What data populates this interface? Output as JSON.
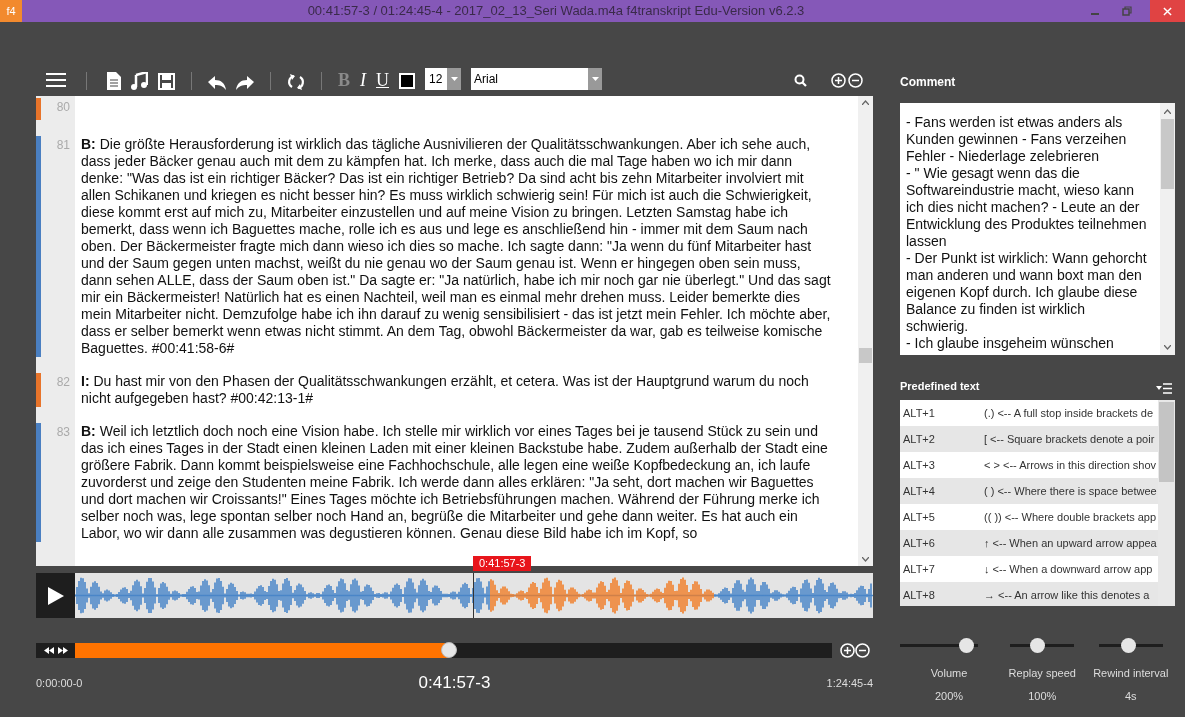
{
  "window": {
    "logo": "f4",
    "title": "00:41:57-3 / 01:24:45-4 - 2017_02_13_Seri Wada.m4a f4transkript Edu-Version v6.2.3"
  },
  "toolbar": {
    "format_buttons": [
      {
        "label": "B",
        "kind": "bold",
        "disabled": true
      },
      {
        "label": "I",
        "kind": "italic",
        "disabled": false
      },
      {
        "label": "U",
        "kind": "underline",
        "disabled": false
      }
    ],
    "font_size": "12",
    "font_family": "Arial"
  },
  "transcript": [
    {
      "number": "80",
      "color": "#e8742a"
    },
    {
      "number": "81",
      "color": "#4a7fc1",
      "text": "**B:** Die größte Herausforderung ist wirklich das tägliche Ausnivilieren der Qualitätsschwankungen. Aber ich sehe auch, dass jeder Bäcker genau auch mit dem zu kämpfen hat. Ich merke, dass auch die mal Tage haben wo ich mir dann denke: \"Was das ist ein richtiger Bäcker? Das ist ein richtiger Betrieb? Da sind acht bis zehn Mitarbeiter involviert mit allen Schikanen und kriegen es nicht besser hin? Es muss wirklich schwierig sein! Für mich ist auch die Schwierigkeit, diese kommt erst auf mich zu, Mitarbeiter einzustellen und auf meine Vision zu bringen. Letzten Samstag habe ich bemerkt, dass wenn ich Baguettes mache, rolle ich es aus und lege es anschließend hin - immer mit dem Saum nach oben. Der Bäckermeister fragte mich dann wieso ich dies so mache. Ich sagte dann: \"Ja wenn du fünf Mitarbeiter hast und der Saum gegen unten machst, weißt du nie genau wo der Saum genau ist. Wenn er hingegen oben sein muss, dann sehen ALLE, dass der Saum oben ist.\" Da sagte er: \"Ja natürlich, habe ich mir noch gar nie überlegt.\" Und das sagt mir ein Bäckermeister! Natürlich hat es einen Nachteil, weil man es einmal mehr drehen muss. Leider bemerkte dies mein Mitarbeiter nicht. Demzufolge habe ich ihn darauf zu wenig sensibilisiert - das ist jetzt mein Fehler. Ich möchte aber, dass er selber bemerkt wenn etwas nicht stimmt. An dem Tag, obwohl Bäckermeister da war, gab es teilweise komische Baguettes. #00:41:58-6#"
    },
    {
      "number": "82",
      "color": "#e8742a",
      "text": "**I:** Du hast mir von den Phasen der Qualitätsschwankungen erzählt, et cetera. Was ist der Hauptgrund warum du noch nicht aufgegeben hast? #00:42:13-1#"
    },
    {
      "number": "83",
      "color": "#4a7fc1",
      "text": "**B:** Weil ich letztlich doch noch eine Vision habe. Ich stelle mir wirklich vor eines Tages bei je tausend Stück zu sein und das ich eines Tages in der Stadt einen kleinen Laden mit einer kleinen Backstube habe. Zudem außerhalb der Stadt eine größere Fabrik. Dann kommt beispielsweise eine Fachhochschule, alle legen eine weiße Kopfbedeckung an, ich laufe zuvorderst und zeige den Studenten meine Fabrik. Ich werde dann alles erklären: \"Ja seht, dort machen wir Baguettes und dort machen wir Croissants!\" Eines Tages möchte ich Betriebsführungen machen. Während der Führung merke ich selber noch was, lege spontan selber noch Hand an, begrüße die Mitarbeiter und gehe dann weiter. Es hat auch ein Labor, wo wir dann alle zusammen was degustieren können. Genau diese Bild habe ich im Kopf, so"
    }
  ],
  "player": {
    "marker": "0:41:57-3",
    "level": 0.494,
    "start_time": "0:00:00-0",
    "current_time": "0:41:57-3",
    "end_time": "1:24:45-4"
  },
  "comment": {
    "label": "Comment",
    "lines": [
      "- Fans werden ist etwas anders als Kunden gewinnen - Fans verzeihen Fehler - Niederlage zelebrieren",
      "- \" Wie gesagt wenn das die Softwareindustrie macht, wieso kann ich dies nicht machen? - Leute an der Entwicklung des Produktes teilnehmen lassen",
      "- Der Punkt ist wirklich: Wann gehorcht man anderen und wann boxt man den eigenen Kopf durch. Ich glaube diese Balance zu finden ist wirklich schwierig.",
      "- Ich glaube insgeheim wünschen"
    ]
  },
  "predefined": {
    "label": "Predefined text",
    "rows": [
      {
        "key": "ALT+1",
        "text": "(.) <-- A full stop inside brackets de"
      },
      {
        "key": "ALT+2",
        "text": "[ <-- Square brackets denote a poir"
      },
      {
        "key": "ALT+3",
        "text": "< > <-- Arrows in this direction shov"
      },
      {
        "key": "ALT+4",
        "text": "( ) <-- Where there is space betwee"
      },
      {
        "key": "ALT+5",
        "text": "(( )) <-- Where double brackets app"
      },
      {
        "key": "ALT+6",
        "text": "↑ <-- When an upward arrow appea"
      },
      {
        "key": "ALT+7",
        "text": "↓ <-- When a downward arrow app"
      },
      {
        "key": "ALT+8",
        "text": "→ <-- An arrow like this denotes a"
      }
    ]
  },
  "sliders": [
    {
      "label": "Volume",
      "value": "200%",
      "level": 0.85
    },
    {
      "label": "Replay speed",
      "value": "100%",
      "level": 0.42
    },
    {
      "label": "Rewind interval",
      "value": "4s",
      "level": 0.46
    }
  ]
}
